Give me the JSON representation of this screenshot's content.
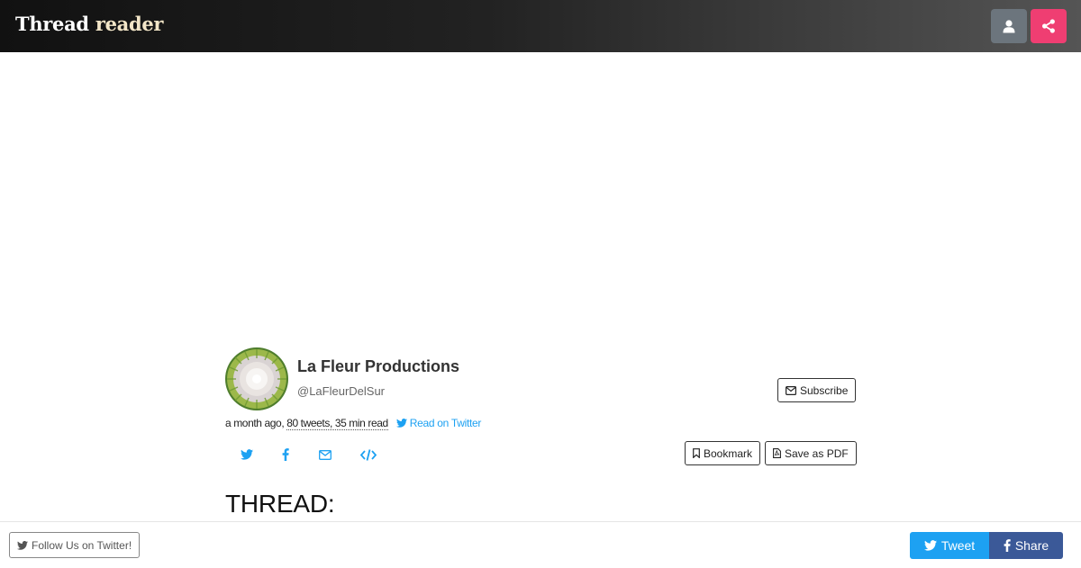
{
  "navbar": {
    "brand_primary": "Thread",
    "brand_accent": "reader",
    "user_icon": "user-icon",
    "share_icon": "share-icon",
    "share_color": "#ef3e72"
  },
  "author": {
    "name": "La Fleur Productions",
    "handle": "@LaFleurDelSur",
    "subscribe_label": "Subscribe"
  },
  "meta": {
    "time_ago": "a month ago,",
    "stats": "80 tweets, 35 min read",
    "read_on_twitter": "Read on Twitter"
  },
  "actions": {
    "bookmark_label": "Bookmark",
    "save_pdf_label": "Save as PDF",
    "share_icons": [
      "twitter-icon",
      "facebook-icon",
      "email-icon",
      "embed-icon"
    ]
  },
  "thread": {
    "heading": "THREAD:"
  },
  "bottom": {
    "follow_label": "Follow Us on Twitter!",
    "tweet_label": "Tweet",
    "share_label": "Share",
    "tweet_color": "#1da1f2",
    "share_color": "#3b5998"
  }
}
